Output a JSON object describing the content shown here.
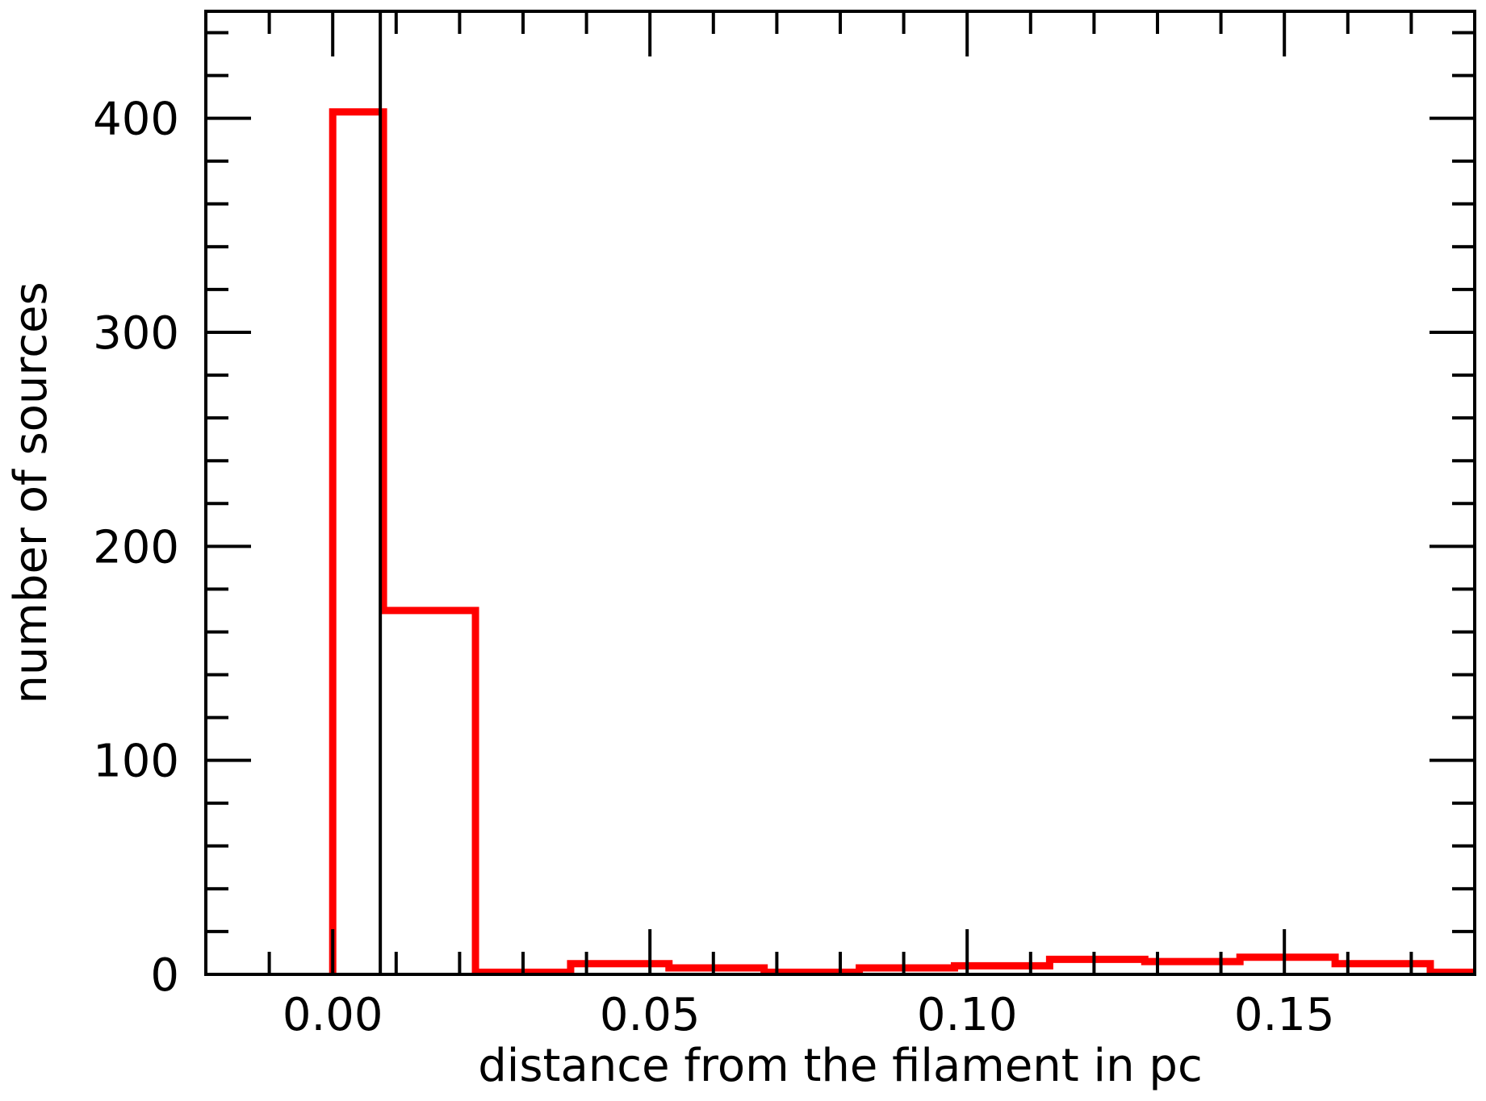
{
  "chart_data": {
    "type": "histogram",
    "title": "",
    "xlabel": "distance from the filament in pc",
    "ylabel": "number of sources",
    "xlim": [
      -0.02,
      0.18
    ],
    "ylim": [
      0,
      450
    ],
    "x_ticks": [
      {
        "value": 0.0,
        "label": "0.00"
      },
      {
        "value": 0.05,
        "label": "0.05"
      },
      {
        "value": 0.1,
        "label": "0.10"
      },
      {
        "value": 0.15,
        "label": "0.15"
      }
    ],
    "y_ticks": [
      {
        "value": 0,
        "label": "0"
      },
      {
        "value": 100,
        "label": "100"
      },
      {
        "value": 200,
        "label": "200"
      },
      {
        "value": 300,
        "label": "300"
      },
      {
        "value": 400,
        "label": "400"
      }
    ],
    "bin_edges": [
      0.0,
      0.008,
      0.0225,
      0.0375,
      0.053,
      0.068,
      0.083,
      0.098,
      0.113,
      0.128,
      0.143,
      0.158,
      0.173,
      0.188
    ],
    "counts": [
      403,
      170,
      1,
      5,
      3,
      1,
      3,
      4,
      7,
      6,
      8,
      5,
      1
    ],
    "vline_x": 0.0075,
    "colors": {
      "histogram": "#ff0000",
      "vline": "#000000",
      "axes": "#000000"
    },
    "grid": false
  }
}
